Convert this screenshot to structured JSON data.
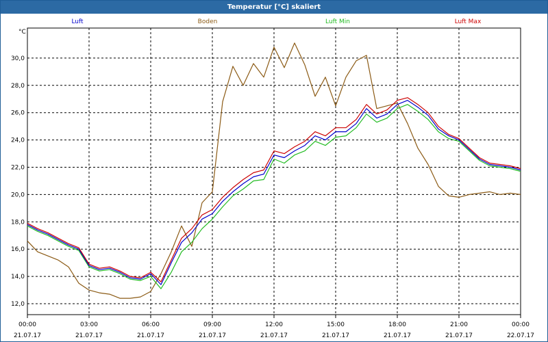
{
  "window": {
    "title": "Temperatur [°C] skaliert"
  },
  "chart_data": {
    "type": "line",
    "title": "Temperatur [°C] skaliert",
    "ylabel": "°C",
    "xlabel": "",
    "ylim": [
      11.2,
      32.2
    ],
    "xlim": [
      0,
      24
    ],
    "yticks": [
      "12,0",
      "14,0",
      "16,0",
      "18,0",
      "20,0",
      "22,0",
      "24,0",
      "26,0",
      "28,0",
      "30,0"
    ],
    "xticks": [
      {
        "time": "00:00",
        "date": "21.07.17",
        "h": 0
      },
      {
        "time": "03:00",
        "date": "21.07.17",
        "h": 3
      },
      {
        "time": "06:00",
        "date": "21.07.17",
        "h": 6
      },
      {
        "time": "09:00",
        "date": "21.07.17",
        "h": 9
      },
      {
        "time": "12:00",
        "date": "21.07.17",
        "h": 12
      },
      {
        "time": "15:00",
        "date": "21.07.17",
        "h": 15
      },
      {
        "time": "18:00",
        "date": "21.07.17",
        "h": 18
      },
      {
        "time": "21:00",
        "date": "21.07.17",
        "h": 21
      },
      {
        "time": "00:00",
        "date": "22.07.17",
        "h": 24
      }
    ],
    "grid": true,
    "legend_position": "top",
    "series": [
      {
        "name": "Luft",
        "color": "#0000cc",
        "x": [
          0,
          0.5,
          1,
          1.5,
          2,
          2.5,
          3,
          3.5,
          4,
          4.5,
          5,
          5.5,
          6,
          6.5,
          7,
          7.5,
          8,
          8.5,
          9,
          9.5,
          10,
          10.5,
          11,
          11.5,
          12,
          12.5,
          13,
          13.5,
          14,
          14.5,
          15,
          15.5,
          16,
          16.5,
          17,
          17.5,
          18,
          18.5,
          19,
          19.5,
          20,
          20.5,
          21,
          21.5,
          22,
          22.5,
          23,
          23.5,
          24
        ],
        "y": [
          17.8,
          17.4,
          17.1,
          16.7,
          16.3,
          16.0,
          14.8,
          14.5,
          14.6,
          14.3,
          13.9,
          13.8,
          14.2,
          13.4,
          15.0,
          16.5,
          17.2,
          18.2,
          18.6,
          19.5,
          20.2,
          20.8,
          21.3,
          21.5,
          22.9,
          22.7,
          23.2,
          23.6,
          24.3,
          24.0,
          24.6,
          24.6,
          25.2,
          26.3,
          25.6,
          25.9,
          26.6,
          26.9,
          26.4,
          25.8,
          24.8,
          24.3,
          24.0,
          23.3,
          22.6,
          22.2,
          22.1,
          22.0,
          21.8
        ]
      },
      {
        "name": "Boden",
        "color": "#8b5a14",
        "x": [
          0,
          0.5,
          1,
          1.5,
          2,
          2.5,
          3,
          3.5,
          4,
          4.5,
          5,
          5.5,
          6,
          6.5,
          7,
          7.5,
          8,
          8.5,
          9,
          9.5,
          10,
          10.5,
          11,
          11.5,
          12,
          12.5,
          13,
          13.5,
          14,
          14.5,
          15,
          15.5,
          16,
          16.5,
          17,
          17.5,
          18,
          18.5,
          19,
          19.5,
          20,
          20.5,
          21,
          21.5,
          22,
          22.5,
          23,
          23.5,
          24
        ],
        "y": [
          16.6,
          15.8,
          15.5,
          15.2,
          14.7,
          13.5,
          13.0,
          12.8,
          12.7,
          12.4,
          12.4,
          12.5,
          12.9,
          14.2,
          15.8,
          17.7,
          16.2,
          19.4,
          20.2,
          26.8,
          29.4,
          28.0,
          29.6,
          28.6,
          30.8,
          29.3,
          31.1,
          29.5,
          27.2,
          28.6,
          26.5,
          28.6,
          29.8,
          30.2,
          26.3,
          26.5,
          26.7,
          25.2,
          23.4,
          22.2,
          20.6,
          19.9,
          19.8,
          20.0,
          20.1,
          20.2,
          20.0,
          20.1,
          20.0
        ]
      },
      {
        "name": "Luft Min",
        "color": "#22bb22",
        "x": [
          0,
          0.5,
          1,
          1.5,
          2,
          2.5,
          3,
          3.5,
          4,
          4.5,
          5,
          5.5,
          6,
          6.5,
          7,
          7.5,
          8,
          8.5,
          9,
          9.5,
          10,
          10.5,
          11,
          11.5,
          12,
          12.5,
          13,
          13.5,
          14,
          14.5,
          15,
          15.5,
          16,
          16.5,
          17,
          17.5,
          18,
          18.5,
          19,
          19.5,
          20,
          20.5,
          21,
          21.5,
          22,
          22.5,
          23,
          23.5,
          24
        ],
        "y": [
          17.7,
          17.3,
          17.0,
          16.6,
          16.2,
          15.9,
          14.7,
          14.4,
          14.5,
          14.2,
          13.8,
          13.7,
          14.0,
          13.1,
          14.3,
          15.8,
          16.5,
          17.5,
          18.2,
          19.1,
          19.9,
          20.4,
          21.0,
          21.1,
          22.6,
          22.3,
          22.9,
          23.2,
          23.9,
          23.6,
          24.2,
          24.3,
          24.9,
          25.9,
          25.3,
          25.6,
          26.3,
          26.6,
          26.1,
          25.5,
          24.6,
          24.1,
          23.9,
          23.2,
          22.5,
          22.1,
          22.0,
          21.9,
          21.7
        ]
      },
      {
        "name": "Luft Max",
        "color": "#cc0000",
        "x": [
          0,
          0.5,
          1,
          1.5,
          2,
          2.5,
          3,
          3.5,
          4,
          4.5,
          5,
          5.5,
          6,
          6.5,
          7,
          7.5,
          8,
          8.5,
          9,
          9.5,
          10,
          10.5,
          11,
          11.5,
          12,
          12.5,
          13,
          13.5,
          14,
          14.5,
          15,
          15.5,
          16,
          16.5,
          17,
          17.5,
          18,
          18.5,
          19,
          19.5,
          20,
          20.5,
          21,
          21.5,
          22,
          22.5,
          23,
          23.5,
          24
        ],
        "y": [
          17.9,
          17.5,
          17.2,
          16.8,
          16.4,
          16.1,
          14.9,
          14.6,
          14.7,
          14.4,
          14.0,
          13.9,
          14.3,
          13.6,
          15.2,
          16.8,
          17.5,
          18.5,
          18.9,
          19.8,
          20.5,
          21.1,
          21.6,
          21.8,
          23.2,
          23.0,
          23.5,
          23.9,
          24.6,
          24.3,
          24.9,
          24.9,
          25.5,
          26.6,
          25.9,
          26.2,
          26.9,
          27.1,
          26.6,
          26.0,
          25.0,
          24.4,
          24.1,
          23.4,
          22.7,
          22.3,
          22.2,
          22.1,
          21.9
        ]
      }
    ]
  }
}
